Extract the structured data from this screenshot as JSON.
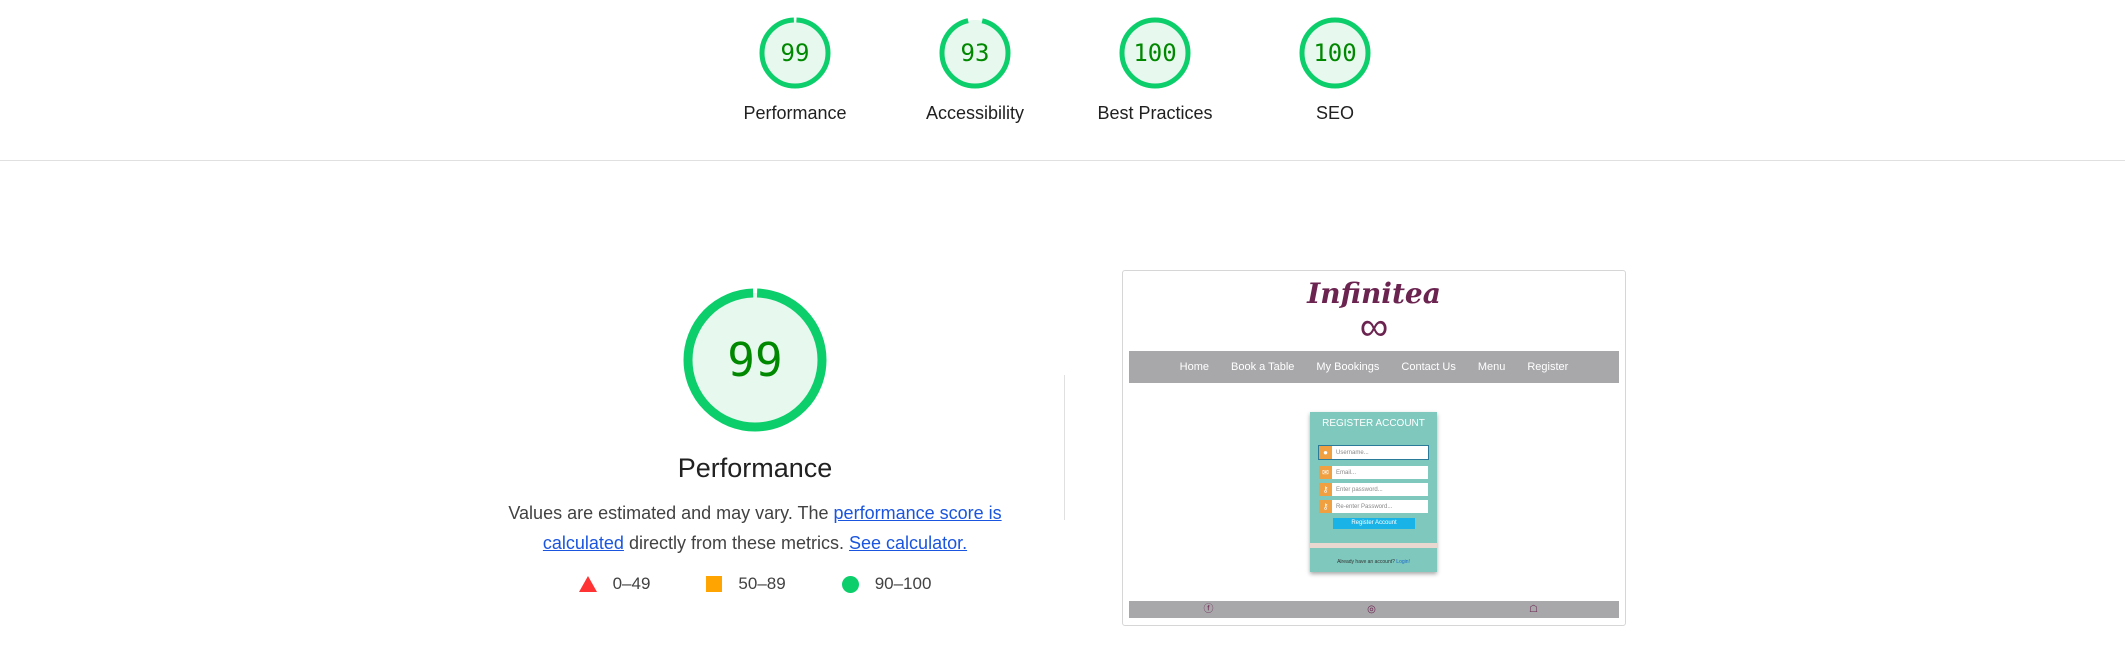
{
  "summary": {
    "gauges": [
      {
        "score": "99",
        "label": "Performance",
        "fraction": 0.99
      },
      {
        "score": "93",
        "label": "Accessibility",
        "fraction": 0.93
      },
      {
        "score": "100",
        "label": "Best Practices",
        "fraction": 1.0
      },
      {
        "score": "100",
        "label": "SEO",
        "fraction": 1.0
      }
    ]
  },
  "performance": {
    "score": "99",
    "fraction": 0.99,
    "title": "Performance",
    "desc_prefix": "Values are estimated and may vary. The ",
    "link_score": "performance score is calculated",
    "desc_middle": " directly from these metrics. ",
    "link_calc": "See calculator.",
    "legend": [
      {
        "range": "0–49",
        "color": "#ff3333",
        "icon": "triangle-icon"
      },
      {
        "range": "50–89",
        "color": "#ffa400",
        "icon": "square-icon"
      },
      {
        "range": "90–100",
        "color": "#0cce6b",
        "icon": "circle-icon"
      }
    ]
  },
  "screenshot": {
    "brand": "Infinitea",
    "infinity": "∞",
    "nav": [
      "Home",
      "Book a Table",
      "My Bookings",
      "Contact Us",
      "Menu",
      "Register"
    ],
    "register_title": "REGISTER ACCOUNT",
    "fields": [
      "Username...",
      "Email...",
      "Enter password...",
      "Re-enter Password..."
    ],
    "button": "Register Account",
    "footer_text": "Already have an account?",
    "login_link": "Login!",
    "social_icons": [
      "facebook-icon",
      "instagram-icon",
      "snapchat-icon"
    ]
  },
  "colors": {
    "pass": "#0cce6b",
    "pass_text": "#008800",
    "pass_bg": "#e7f8ee",
    "link": "#1a55e0"
  }
}
